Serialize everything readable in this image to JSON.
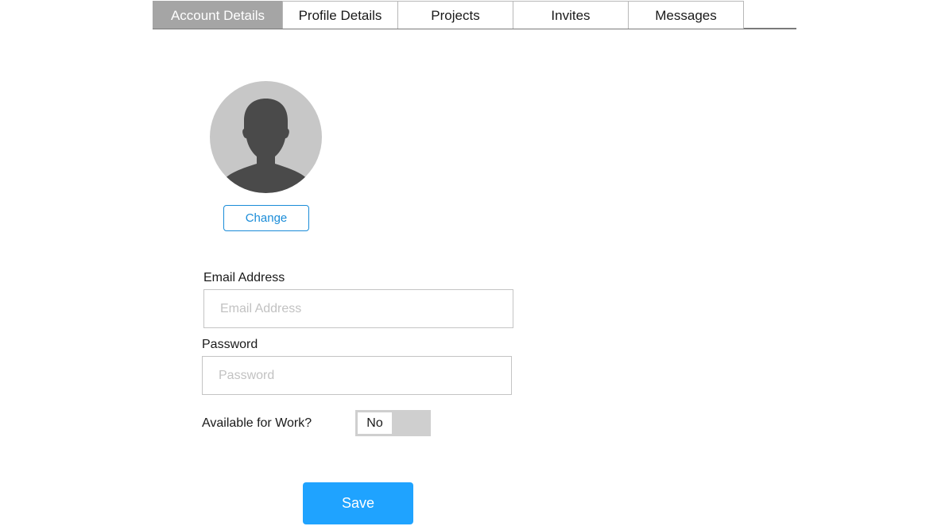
{
  "tabs": [
    {
      "label": "Account Details",
      "active": true
    },
    {
      "label": "Profile Details",
      "active": false
    },
    {
      "label": "Projects",
      "active": false
    },
    {
      "label": "Invites",
      "active": false
    },
    {
      "label": "Messages",
      "active": false
    }
  ],
  "avatar": {
    "icon": "user-silhouette-icon",
    "change_label": "Change"
  },
  "form": {
    "email": {
      "label": "Email Address",
      "value": "",
      "placeholder": "Email Address"
    },
    "password": {
      "label": "Password",
      "value": "",
      "placeholder": "Password"
    },
    "available": {
      "label": "Available for Work?",
      "state": "No"
    },
    "save_label": "Save"
  },
  "colors": {
    "active_tab_bg": "#a5a5a5",
    "accent_blue": "#1fa3ff",
    "link_blue": "#1a8cd8",
    "avatar_bg": "#c7c7c7",
    "avatar_figure": "#4a4a4a"
  }
}
